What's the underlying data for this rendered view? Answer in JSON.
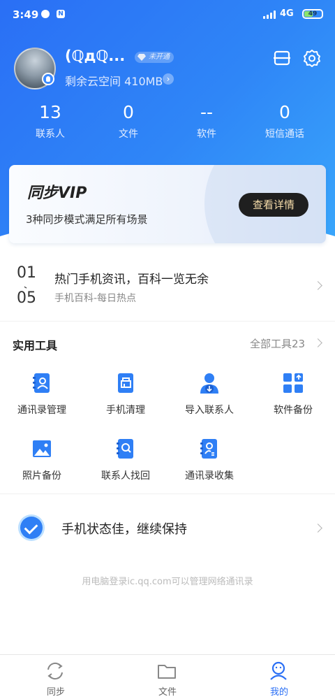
{
  "status_bar": {
    "time": "3:49",
    "app_icon_1": "N",
    "network": "4G",
    "battery": "49"
  },
  "profile": {
    "nickname": "(ℚдℚ...",
    "vip_tag": "未开通",
    "cloud_space": "剩余云空间 410MB"
  },
  "stats": [
    {
      "value": "13",
      "label": "联系人"
    },
    {
      "value": "0",
      "label": "文件"
    },
    {
      "value": "--",
      "label": "软件"
    },
    {
      "value": "0",
      "label": "短信通话"
    }
  ],
  "vip_card": {
    "title": "同步VIP",
    "subtitle": "3种同步模式满足所有场景",
    "button": "查看详情"
  },
  "news": {
    "date_month": "01",
    "date_day": "05",
    "title": "热门手机资讯，百科一览无余",
    "subtitle": "手机百科-每日热点"
  },
  "tools": {
    "title": "实用工具",
    "all_label": "全部工具23",
    "items": [
      {
        "label": "通讯录管理",
        "icon": "contacts-book-icon"
      },
      {
        "label": "手机清理",
        "icon": "phone-clean-icon"
      },
      {
        "label": "导入联系人",
        "icon": "import-contact-icon"
      },
      {
        "label": "软件备份",
        "icon": "app-backup-icon"
      },
      {
        "label": "照片备份",
        "icon": "photo-backup-icon"
      },
      {
        "label": "联系人找回",
        "icon": "contact-recover-icon"
      },
      {
        "label": "通讯录收集",
        "icon": "contacts-collect-icon"
      }
    ]
  },
  "phone_status": "手机状态佳，继续保持",
  "footer_note": "用电脑登录ic.qq.com可以管理网络通讯录",
  "bottom_nav": [
    {
      "label": "同步",
      "icon": "sync-icon",
      "active": false
    },
    {
      "label": "文件",
      "icon": "folder-icon",
      "active": false
    },
    {
      "label": "我的",
      "icon": "profile-icon",
      "active": true
    }
  ],
  "colors": {
    "primary": "#2a6ff5",
    "hero_end": "#39a6fb",
    "vip_button": "#1f1f1f",
    "vip_button_text": "#f6dcaa"
  }
}
